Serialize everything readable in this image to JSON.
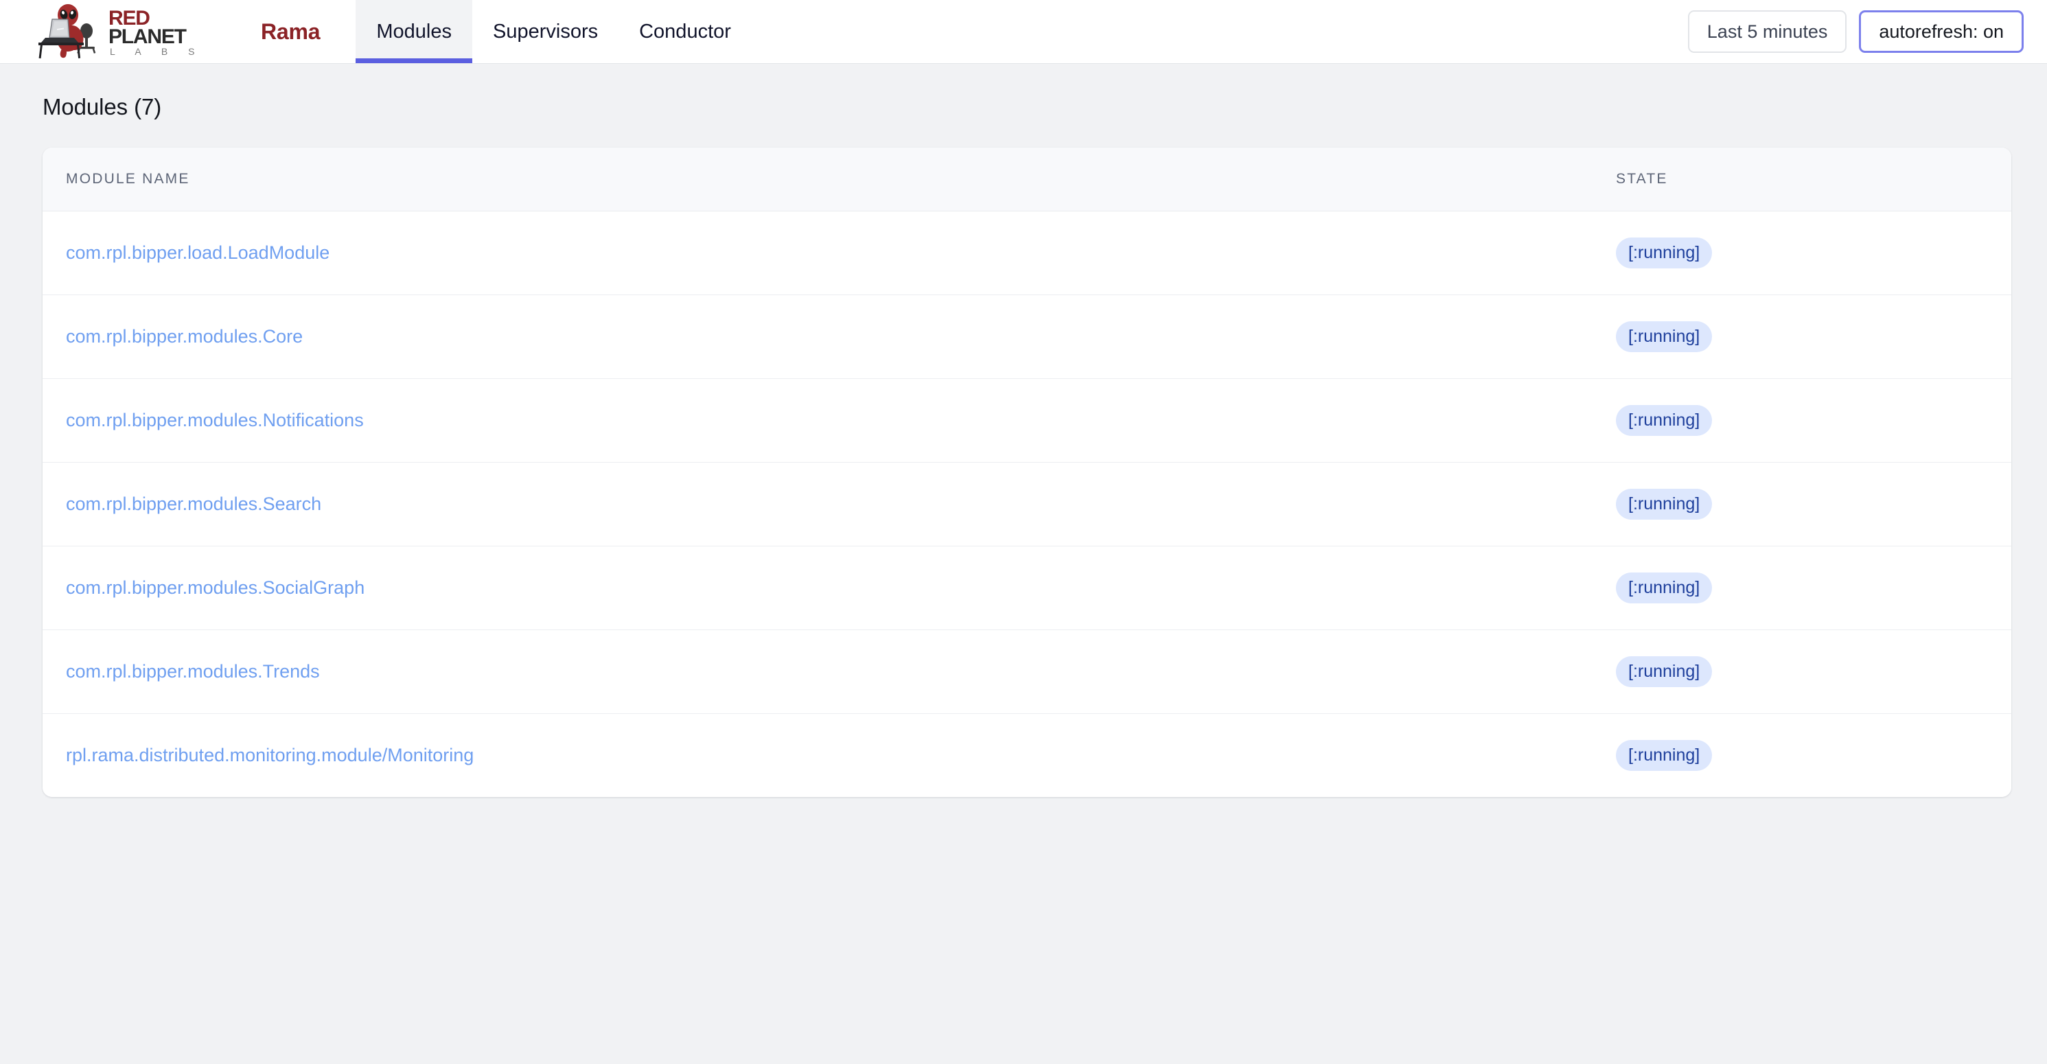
{
  "header": {
    "logo": {
      "mascot_icon": "alien-at-laptop-icon",
      "word_red": "RED",
      "word_planet": "PLANET",
      "word_labs": "L A B S",
      "product_name": "Rama",
      "red_color": "#8b2226",
      "dark_color": "#2b2b2b",
      "labs_color": "#7b7b7b"
    },
    "tabs": [
      {
        "label": "Modules",
        "active": true
      },
      {
        "label": "Supervisors",
        "active": false
      },
      {
        "label": "Conductor",
        "active": false
      }
    ],
    "active_tab_color": "#5b5fe0",
    "controls": {
      "time_range_label": "Last 5 minutes",
      "autorefresh_label": "autorefresh: on",
      "focus_color": "#7c80ec"
    }
  },
  "main": {
    "page_title": "Modules (7)",
    "table": {
      "columns": [
        {
          "key": "module_name",
          "label": "MODULE NAME"
        },
        {
          "key": "state",
          "label": "STATE"
        }
      ],
      "rows": [
        {
          "module_name": "com.rpl.bipper.load.LoadModule",
          "state": "[:running]"
        },
        {
          "module_name": "com.rpl.bipper.modules.Core",
          "state": "[:running]"
        },
        {
          "module_name": "com.rpl.bipper.modules.Notifications",
          "state": "[:running]"
        },
        {
          "module_name": "com.rpl.bipper.modules.Search",
          "state": "[:running]"
        },
        {
          "module_name": "com.rpl.bipper.modules.SocialGraph",
          "state": "[:running]"
        },
        {
          "module_name": "com.rpl.bipper.modules.Trends",
          "state": "[:running]"
        },
        {
          "module_name": "rpl.rama.distributed.monitoring.module/Monitoring",
          "state": "[:running]"
        }
      ],
      "link_color": "#6f9ff0",
      "badge_bg": "#dde7fd",
      "badge_text_color": "#1e3f9c"
    }
  }
}
